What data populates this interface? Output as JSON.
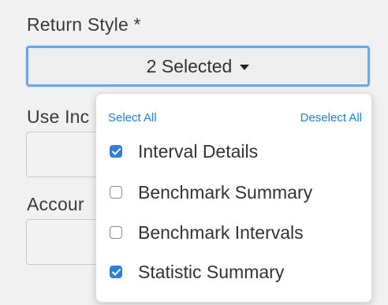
{
  "return_style": {
    "label": "Return Style *",
    "selected_text": "2 Selected"
  },
  "use_field": {
    "label_partial": "Use Inc"
  },
  "account_field": {
    "label_partial": "Accour"
  },
  "dropdown": {
    "select_all": "Select All",
    "deselect_all": "Deselect All",
    "options": [
      {
        "label": "Interval Details",
        "checked": true
      },
      {
        "label": "Benchmark Summary",
        "checked": false
      },
      {
        "label": "Benchmark Intervals",
        "checked": false
      },
      {
        "label": "Statistic Summary",
        "checked": true
      }
    ]
  },
  "colors": {
    "accent": "#2f7fd8",
    "focus_border": "#6aa6ea",
    "link": "#1f7fd0"
  },
  "icons": {
    "caret": "caret-down-icon",
    "check": "check-icon"
  }
}
